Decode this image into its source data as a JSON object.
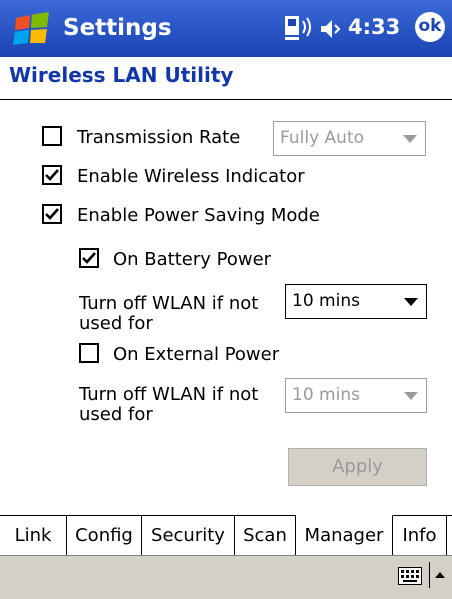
{
  "titlebar": {
    "app_title": "Settings",
    "time": "4:33",
    "ok_label": "ok",
    "icons": [
      "windows-start-icon",
      "connectivity-icon",
      "volume-icon"
    ]
  },
  "page": {
    "subtitle": "Wireless LAN Utility"
  },
  "settings": {
    "transmission_rate": {
      "label": "Transmission Rate",
      "checked": false,
      "value": "Fully Auto",
      "enabled": false
    },
    "wireless_indicator": {
      "label": "Enable Wireless Indicator",
      "checked": true
    },
    "power_saving": {
      "label": "Enable Power Saving Mode",
      "checked": true
    },
    "battery_power": {
      "label": "On Battery Power",
      "checked": true,
      "turnoff_label": "Turn off WLAN if not used for",
      "value": "10 mins",
      "enabled": true
    },
    "external_power": {
      "label": "On External Power",
      "checked": false,
      "turnoff_label": "Turn off WLAN if not used for",
      "value": "10 mins",
      "enabled": false
    },
    "apply_label": "Apply"
  },
  "tabs": [
    {
      "label": "Link",
      "active": false
    },
    {
      "label": "Config",
      "active": false
    },
    {
      "label": "Security",
      "active": false
    },
    {
      "label": "Scan",
      "active": false
    },
    {
      "label": "Manager",
      "active": true
    },
    {
      "label": "Info",
      "active": false
    }
  ],
  "menubar": {
    "icons": [
      "keyboard-icon",
      "input-selector-arrow-icon"
    ]
  },
  "colors": {
    "titlebar": "#1b44b4",
    "subtitle": "#1238a8",
    "disabled_text": "#9a9a9a",
    "menubar": "#d4d0c8"
  }
}
